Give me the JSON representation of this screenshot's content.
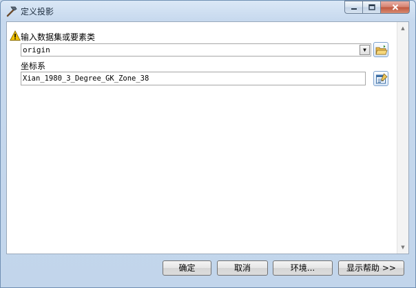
{
  "window": {
    "title": "定义投影",
    "icon": "hammer-tool-icon",
    "controls": {
      "minimize": "minimize-icon",
      "maximize": "maximize-icon",
      "close": "close-icon"
    }
  },
  "form": {
    "input_dataset": {
      "label": "输入数据集或要素类",
      "value": "origin",
      "status_icon": "warning-icon"
    },
    "coordinate_system": {
      "label": "坐标系",
      "value": "Xian_1980_3_Degree_GK_Zone_38"
    }
  },
  "buttons": {
    "ok": "确定",
    "cancel": "取消",
    "environments": "环境...",
    "show_help": "显示帮助 >>"
  },
  "colors": {
    "title_bar": "#c7d9ee",
    "close_button": "#c0563d",
    "warning": "#f2c200",
    "folder": "#e8b84a"
  }
}
